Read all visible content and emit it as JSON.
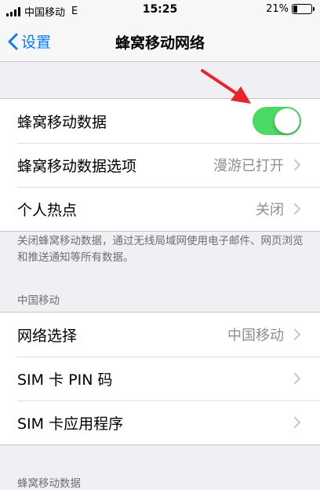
{
  "status_bar": {
    "carrier": "中国移动",
    "network": "E",
    "time": "15:25",
    "battery_percent": "21%",
    "battery_level": 0.21
  },
  "nav": {
    "back_label": "设置",
    "title": "蜂窝移动网络"
  },
  "cellular_group": {
    "cellular_data_label": "蜂窝移动数据",
    "cellular_data_on": true,
    "options_label": "蜂窝移动数据选项",
    "options_value": "漫游已打开",
    "hotspot_label": "个人热点",
    "hotspot_value": "关闭"
  },
  "footer_note": "关闭蜂窝移动数据，通过无线局域网使用电子邮件、网页浏览和推送通知等所有数据。",
  "carrier_section": {
    "header": "中国移动",
    "network_select_label": "网络选择",
    "network_select_value": "中国移动",
    "sim_pin_label": "SIM 卡 PIN 码",
    "sim_apps_label": "SIM 卡应用程序"
  },
  "next_section_header": "蜂窝移动数据",
  "colors": {
    "accent": "#0a7aff",
    "toggle_on": "#4cd964",
    "annotation_arrow": "#e8242b"
  }
}
